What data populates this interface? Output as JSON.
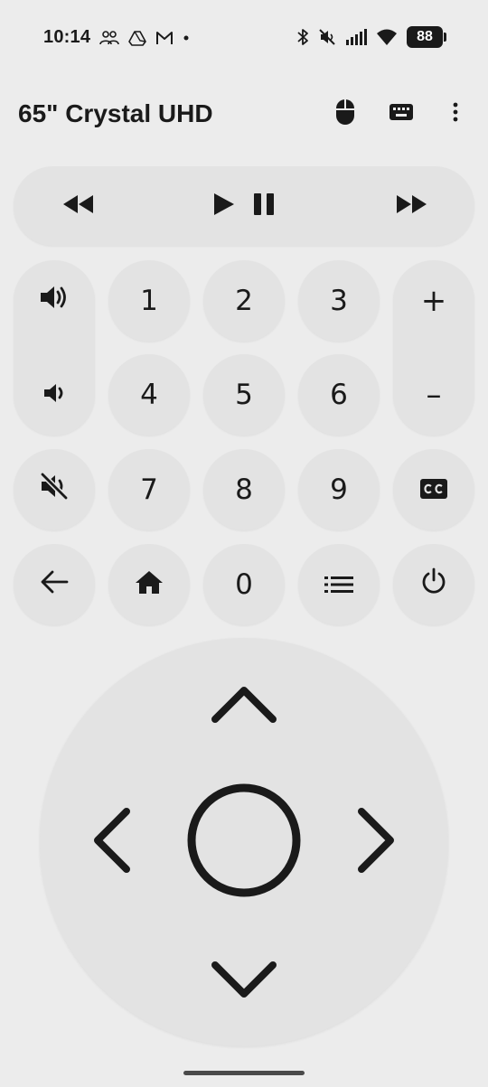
{
  "status_bar": {
    "time": "10:14",
    "left_icons": [
      "people-icon",
      "drive-icon",
      "gmail-icon",
      "dot-icon"
    ],
    "right_icons": [
      "bluetooth-icon",
      "mute-icon",
      "signal-icon",
      "wifi-icon"
    ],
    "battery": "88"
  },
  "header": {
    "title": "65\" Crystal UHD",
    "actions": [
      "mouse-icon",
      "keyboard-icon",
      "more-vert-icon"
    ]
  },
  "media": {
    "rewind": "rewind-icon",
    "play_pause": "play-pause-icon",
    "fast_forward": "fast-forward-icon"
  },
  "keypad": {
    "digits": [
      "1",
      "2",
      "3",
      "4",
      "5",
      "6",
      "7",
      "8",
      "9",
      "0"
    ],
    "channel_up": "+",
    "channel_down": "–",
    "icons": {
      "volume_up": "volume-up-icon",
      "volume_down": "volume-down-icon",
      "mute": "volume-off-icon",
      "captions": "closed-captions-icon",
      "back": "back-arrow-icon",
      "home": "home-icon",
      "menu": "list-menu-icon",
      "power": "power-icon"
    }
  },
  "dpad": {
    "up": "chevron-up-icon",
    "down": "chevron-down-icon",
    "left": "chevron-left-icon",
    "right": "chevron-right-icon",
    "ok": "ok-circle-icon"
  },
  "colors": {
    "background": "#ececec",
    "button": "#e3e3e3",
    "foreground": "#1a1a1a"
  }
}
